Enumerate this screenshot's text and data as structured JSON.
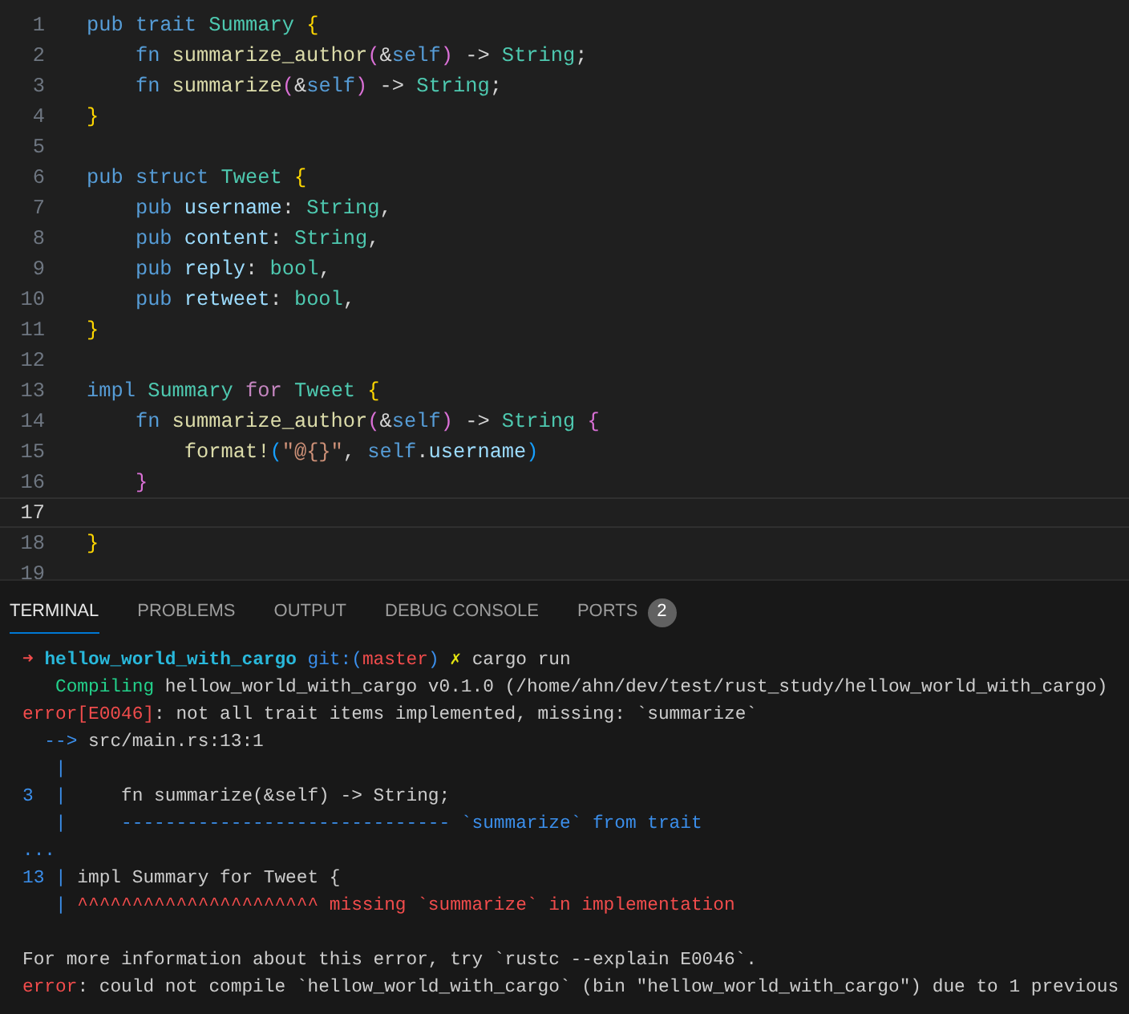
{
  "editor": {
    "lines": [
      {
        "number": "1",
        "current": false,
        "tokens": [
          {
            "keyword": "pub trait"
          },
          {
            "type": " Summary"
          },
          {
            "brace1": " {"
          }
        ]
      },
      {
        "number": "2",
        "current": false,
        "tokens": [
          {
            "keyword": "    fn"
          },
          {
            "function": " summarize_author"
          },
          {
            "brace2": "("
          },
          {
            "plain": "&"
          },
          {
            "keyword": "self"
          },
          {
            "brace2": ")"
          },
          {
            "plain": " ->"
          },
          {
            "type": " String"
          },
          {
            "plain": ";"
          }
        ]
      },
      {
        "number": "3",
        "current": false,
        "tokens": [
          {
            "keyword": "    fn"
          },
          {
            "function": " summarize"
          },
          {
            "brace2": "("
          },
          {
            "plain": "&"
          },
          {
            "keyword": "self"
          },
          {
            "brace2": ")"
          },
          {
            "plain": " ->"
          },
          {
            "type": " String"
          },
          {
            "plain": ";"
          }
        ]
      },
      {
        "number": "4",
        "current": false,
        "tokens": [
          {
            "brace1": "}"
          }
        ]
      },
      {
        "number": "5",
        "current": false
      },
      {
        "number": "6",
        "current": false,
        "tokens": [
          {
            "keyword": "pub struct"
          },
          {
            "type": " Tweet"
          },
          {
            "brace1": " {"
          }
        ]
      },
      {
        "number": "7",
        "current": false,
        "tokens": [
          {
            "keyword": "    pub"
          },
          {
            "variable": " username"
          },
          {
            "plain": ":"
          },
          {
            "type": " String"
          },
          {
            "plain": ","
          }
        ]
      },
      {
        "number": "8",
        "current": false,
        "tokens": [
          {
            "keyword": "    pub"
          },
          {
            "variable": " content"
          },
          {
            "plain": ":"
          },
          {
            "type": " String"
          },
          {
            "plain": ","
          }
        ]
      },
      {
        "number": "9",
        "current": false,
        "tokens": [
          {
            "keyword": "    pub"
          },
          {
            "variable": " reply"
          },
          {
            "plain": ":"
          },
          {
            "type": " bool"
          },
          {
            "plain": ","
          }
        ]
      },
      {
        "number": "10",
        "current": false,
        "tokens": [
          {
            "keyword": "    pub"
          },
          {
            "variable": " retweet"
          },
          {
            "plain": ":"
          },
          {
            "type": " bool"
          },
          {
            "plain": ","
          }
        ]
      },
      {
        "number": "11",
        "current": false,
        "tokens": [
          {
            "brace1": "}"
          }
        ]
      },
      {
        "number": "12",
        "current": false
      },
      {
        "number": "13",
        "current": false,
        "tokens": [
          {
            "keyword": "impl"
          },
          {
            "type": " Summary"
          },
          {
            "control": " for"
          },
          {
            "type": " Tweet"
          },
          {
            "brace1": " {"
          }
        ]
      },
      {
        "number": "14",
        "current": false,
        "tokens": [
          {
            "keyword": "    fn"
          },
          {
            "function": " summarize_author"
          },
          {
            "brace2": "("
          },
          {
            "plain": "&"
          },
          {
            "keyword": "self"
          },
          {
            "brace2": ")"
          },
          {
            "plain": " ->"
          },
          {
            "type": " String"
          },
          {
            "brace2": " {"
          }
        ]
      },
      {
        "number": "15",
        "current": false,
        "tokens": [
          {
            "function": "        format!"
          },
          {
            "brace3": "("
          },
          {
            "string": "\"@{}\""
          },
          {
            "plain": ","
          },
          {
            "keyword": " self"
          },
          {
            "plain": "."
          },
          {
            "variable": "username"
          },
          {
            "brace3": ")"
          }
        ]
      },
      {
        "number": "16",
        "current": false,
        "tokens": [
          {
            "brace2": "    }"
          }
        ]
      },
      {
        "number": "17",
        "current": true
      },
      {
        "number": "18",
        "current": false,
        "tokens": [
          {
            "brace1": "}"
          }
        ]
      },
      {
        "number": "19",
        "current": false
      }
    ]
  },
  "panel_tabs": [
    {
      "label": "TERMINAL",
      "selected": true
    },
    {
      "label": "PROBLEMS",
      "selected": false
    },
    {
      "label": "OUTPUT",
      "selected": false
    },
    {
      "label": "DEBUG CONSOLE",
      "selected": false
    },
    {
      "label": "PORTS",
      "selected": false,
      "badge": "2"
    }
  ],
  "terminal": {
    "lines": [
      {
        "spans": [
          {
            "red": "➜"
          },
          {
            "cyan": " hellow_world_with_cargo"
          },
          {
            "blue": " git:("
          },
          {
            "red": "master"
          },
          {
            "blue": ")"
          },
          {
            "yellow": " ✗"
          },
          {
            "white": " cargo run"
          }
        ]
      },
      {
        "spans": [
          {
            "green": "   Compiling"
          },
          {
            "white": " hellow_world_with_cargo v0.1.0 (/home/ahn/dev/test/rust_study/hellow_world_with_cargo)"
          }
        ]
      },
      {
        "spans": [
          {
            "red": "error[E0046]"
          },
          {
            "white": ": not all trait items implemented, missing: `summarize`"
          }
        ]
      },
      {
        "spans": [
          {
            "blue": "  -->"
          },
          {
            "white": " src/main.rs:13:1"
          }
        ]
      },
      {
        "spans": [
          {
            "blue": "   |"
          }
        ]
      },
      {
        "spans": [
          {
            "blue": "3  |"
          },
          {
            "white": "     fn summarize(&self) -> String;"
          }
        ]
      },
      {
        "spans": [
          {
            "blue": "   |     ------------------------------ `summarize` from trait"
          }
        ]
      },
      {
        "spans": [
          {
            "blue": "..."
          }
        ]
      },
      {
        "spans": [
          {
            "blue": "13 |"
          },
          {
            "white": " impl Summary for Tweet {"
          }
        ]
      },
      {
        "spans": [
          {
            "blue": "   |"
          },
          {
            "red": " ^^^^^^^^^^^^^^^^^^^^^^ missing `summarize` in implementation"
          }
        ]
      }
    ],
    "summary_lines": [
      {
        "spans": [
          {
            "white": "For more information about this error, try `rustc --explain E0046`."
          }
        ]
      },
      {
        "spans": [
          {
            "red": "error"
          },
          {
            "white": ": could not compile `hellow_world_with_cargo` (bin \"hellow_world_with_cargo\") due to 1 previous"
          }
        ]
      }
    ]
  }
}
